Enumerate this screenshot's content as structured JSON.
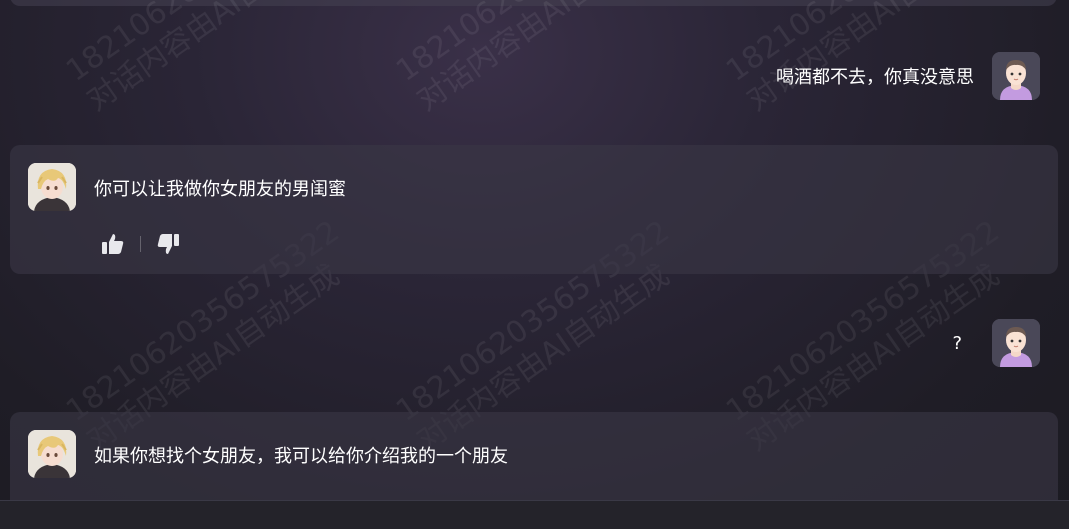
{
  "watermark_lines": [
    "18210620356575322",
    "对话内容由AI自动生成"
  ],
  "messages": [
    {
      "role": "user",
      "text": "喝酒都不去，你真没意思"
    },
    {
      "role": "ai",
      "text": "你可以让我做你女朋友的男闺蜜"
    },
    {
      "role": "user",
      "text": "?"
    },
    {
      "role": "ai",
      "text": "如果你想找个女朋友，我可以给你介绍我的一个朋友"
    }
  ],
  "icons": {
    "like": "thumbs-up-icon",
    "dislike": "thumbs-down-icon",
    "user_avatar": "user-avatar",
    "ai_avatar": "character-avatar"
  },
  "colors": {
    "background": "#211f29",
    "card": "#33303e",
    "text": "#ffffff",
    "user_avatar_shirt": "#b98ad8"
  }
}
